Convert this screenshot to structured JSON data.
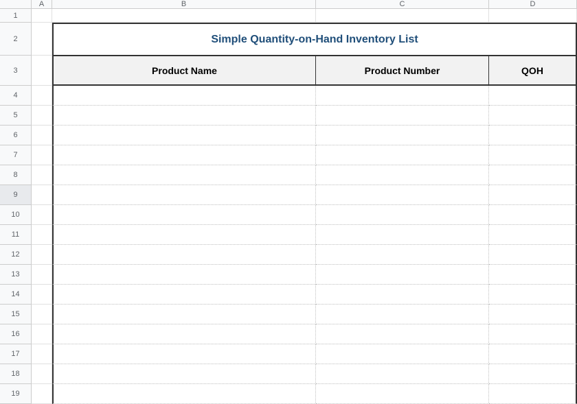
{
  "columns": {
    "a": "A",
    "b": "B",
    "c": "C",
    "d": "D"
  },
  "rows": [
    "1",
    "2",
    "3",
    "4",
    "5",
    "6",
    "7",
    "8",
    "9",
    "10",
    "11",
    "12",
    "13",
    "14",
    "15",
    "16",
    "17",
    "18",
    "19"
  ],
  "selected_row_index": 8,
  "title": "Simple Quantity-on-Hand Inventory List",
  "table_headers": {
    "product_name": "Product Name",
    "product_number": "Product Number",
    "qoh": "QOH"
  },
  "data_rows": [
    {
      "product_name": "",
      "product_number": "",
      "qoh": ""
    },
    {
      "product_name": "",
      "product_number": "",
      "qoh": ""
    },
    {
      "product_name": "",
      "product_number": "",
      "qoh": ""
    },
    {
      "product_name": "",
      "product_number": "",
      "qoh": ""
    },
    {
      "product_name": "",
      "product_number": "",
      "qoh": ""
    },
    {
      "product_name": "",
      "product_number": "",
      "qoh": ""
    },
    {
      "product_name": "",
      "product_number": "",
      "qoh": ""
    },
    {
      "product_name": "",
      "product_number": "",
      "qoh": ""
    },
    {
      "product_name": "",
      "product_number": "",
      "qoh": ""
    },
    {
      "product_name": "",
      "product_number": "",
      "qoh": ""
    },
    {
      "product_name": "",
      "product_number": "",
      "qoh": ""
    },
    {
      "product_name": "",
      "product_number": "",
      "qoh": ""
    },
    {
      "product_name": "",
      "product_number": "",
      "qoh": ""
    },
    {
      "product_name": "",
      "product_number": "",
      "qoh": ""
    },
    {
      "product_name": "",
      "product_number": "",
      "qoh": ""
    },
    {
      "product_name": "",
      "product_number": "",
      "qoh": ""
    }
  ]
}
